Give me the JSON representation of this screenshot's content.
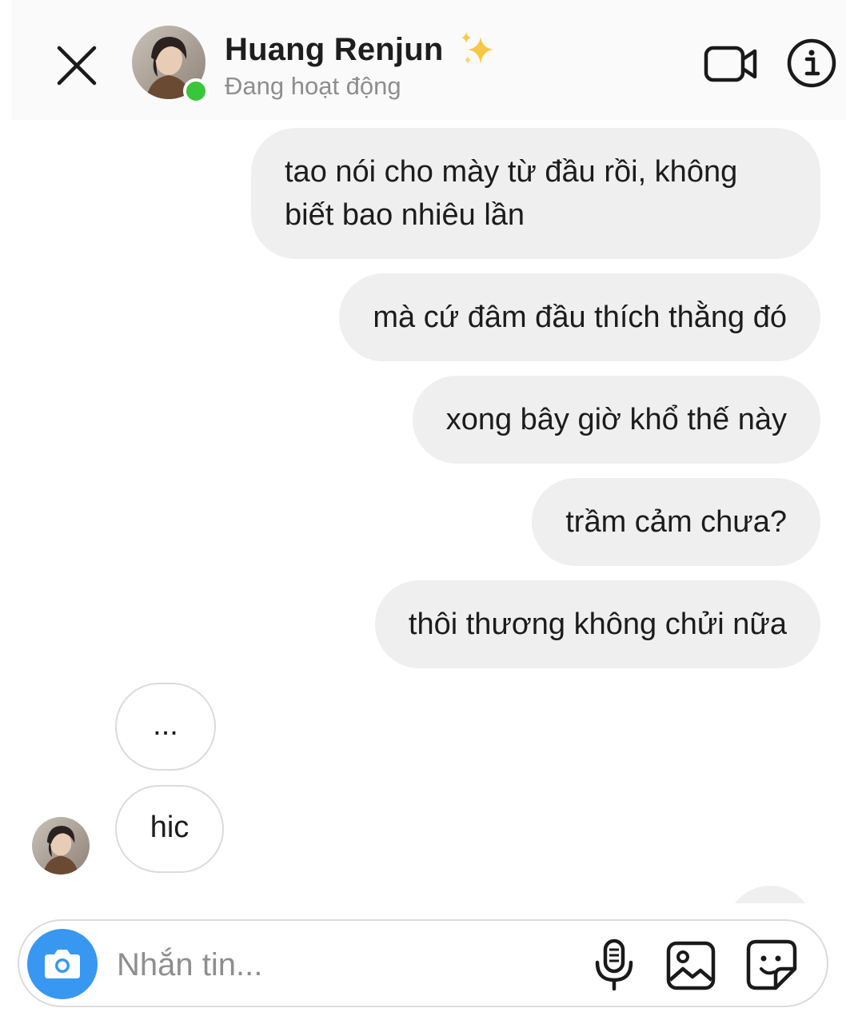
{
  "header": {
    "contact_name": "Huang Renjun",
    "name_emoji": "✨",
    "status": "Đang hoạt động",
    "close_icon": "close-icon",
    "video_icon": "video-camera-icon",
    "info_icon": "info-icon",
    "online_color": "#3ac63a"
  },
  "messages": {
    "outgoing": [
      "tao nói cho mày từ đầu rồi, không biết bao nhiêu lần",
      "mà cứ đâm đầu thích thằng đó",
      "xong bây giờ khổ thế này",
      "trầm cảm chưa?",
      "thôi thương không chửi nữa"
    ],
    "incoming": [
      "...",
      "hic"
    ],
    "outgoing_bubble_color": "#efefef",
    "incoming_border_color": "#dbdbdb"
  },
  "composer": {
    "placeholder": "Nhắn tin...",
    "value": "",
    "camera_icon": "camera-icon",
    "mic_icon": "microphone-icon",
    "gallery_icon": "image-gallery-icon",
    "sticker_icon": "sticker-icon",
    "camera_color": "#3897f0"
  }
}
